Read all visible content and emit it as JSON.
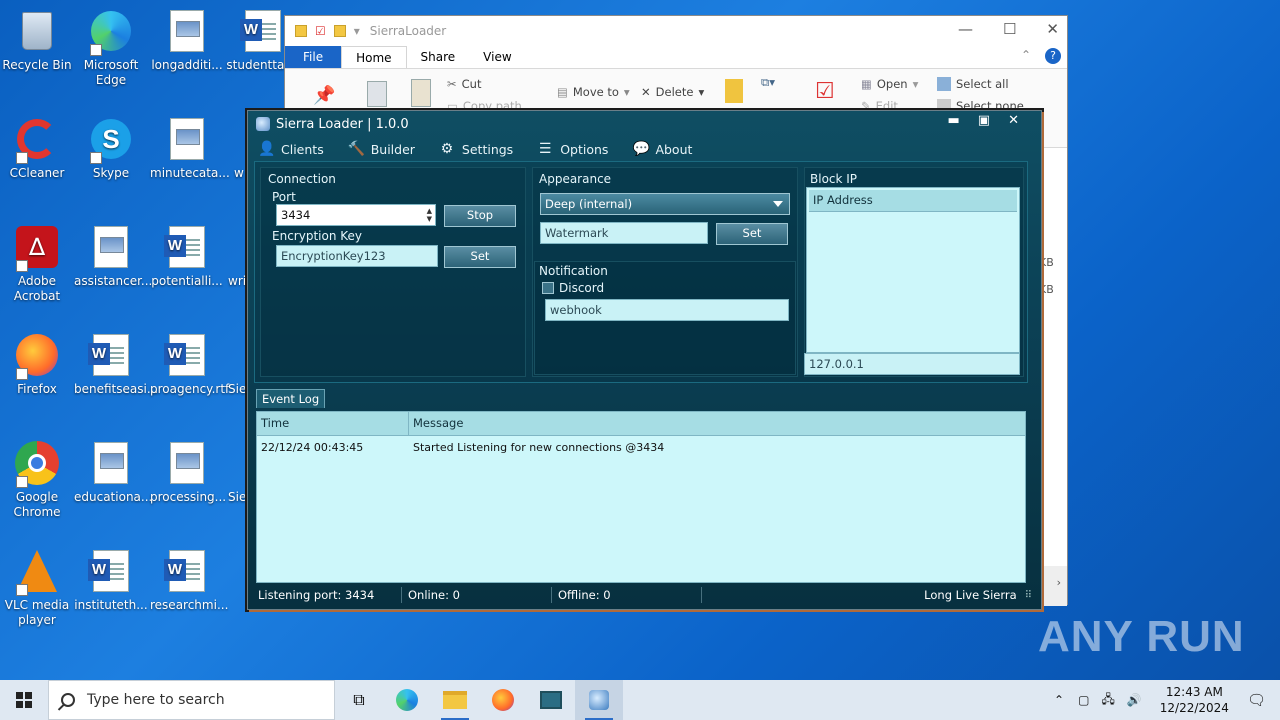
{
  "desktop": {
    "icons": [
      {
        "label": "Recycle Bin",
        "icon": "recycle-bin-icon"
      },
      {
        "label": "Microsoft Edge",
        "icon": "edge-icon"
      },
      {
        "label": "longadditi...",
        "icon": "image-file-icon"
      },
      {
        "label": "studenttar...",
        "icon": "word-doc-icon"
      },
      {
        "label": "CCleaner",
        "icon": "ccleaner-icon"
      },
      {
        "label": "Skype",
        "icon": "skype-icon"
      },
      {
        "label": "minutecata...",
        "icon": "image-file-icon"
      },
      {
        "label": "Adobe Acrobat",
        "icon": "acrobat-icon"
      },
      {
        "label": "assistancer...",
        "icon": "image-file-icon"
      },
      {
        "label": "potentialli...",
        "icon": "word-doc-icon"
      },
      {
        "label": "Firefox",
        "icon": "firefox-icon"
      },
      {
        "label": "benefitseasi...",
        "icon": "word-doc-icon"
      },
      {
        "label": "proagency.rtf",
        "icon": "word-doc-icon"
      },
      {
        "label": "Google Chrome",
        "icon": "chrome-icon"
      },
      {
        "label": "educationa...",
        "icon": "image-file-icon"
      },
      {
        "label": "processing...",
        "icon": "image-file-icon"
      },
      {
        "label": "VLC media player",
        "icon": "vlc-icon"
      },
      {
        "label": "instituteth...",
        "icon": "word-doc-icon"
      },
      {
        "label": "researchmi...",
        "icon": "word-doc-icon"
      }
    ],
    "partial_labels": [
      "w",
      "wri",
      "Sie",
      "Sie"
    ]
  },
  "explorer": {
    "title": "SierraLoader",
    "tabs": [
      "File",
      "Home",
      "Share",
      "View"
    ],
    "ribbon": {
      "cut": "Cut",
      "copy_path": "Copy path",
      "move_to": "Move to",
      "delete": "Delete",
      "open": "Open",
      "edit": "Edit",
      "select_all": "Select all",
      "select_none": "Select none"
    },
    "side_sizes": [
      "KB",
      "KB"
    ]
  },
  "app": {
    "title": "Sierra Loader | 1.0.0",
    "menu": [
      {
        "label": "Clients",
        "icon": "user-icon"
      },
      {
        "label": "Builder",
        "icon": "hammer-icon"
      },
      {
        "label": "Settings",
        "icon": "gears-icon"
      },
      {
        "label": "Options",
        "icon": "list-icon"
      },
      {
        "label": "About",
        "icon": "chat-icon"
      }
    ],
    "connection": {
      "group_label": "Connection",
      "port_label": "Port",
      "port_value": "3434",
      "stop_label": "Stop",
      "key_label": "Encryption Key",
      "key_value": "EncryptionKey123",
      "set_label": "Set"
    },
    "appearance": {
      "group_label": "Appearance",
      "theme_value": "Deep (internal)",
      "watermark_value": "Watermark",
      "set_label": "Set"
    },
    "notification": {
      "group_label": "Notification",
      "discord_label": "Discord",
      "webhook_value": "webhook"
    },
    "block_ip": {
      "group_label": "Block IP",
      "column": "IP Address",
      "input_value": "127.0.0.1"
    },
    "event_log": {
      "tab_label": "Event Log",
      "columns": [
        "Time",
        "Message"
      ],
      "rows": [
        {
          "time": "22/12/24 00:43:45",
          "message": "Started Listening for new connections @3434"
        }
      ]
    },
    "status": {
      "listening": "Listening port: 3434",
      "online": "Online: 0",
      "offline": "Offline: 0",
      "tagline": "Long Live Sierra"
    }
  },
  "taskbar": {
    "search_placeholder": "Type here to search",
    "time": "12:43 AM",
    "date": "12/22/2024"
  },
  "watermark": "ANY RUN"
}
